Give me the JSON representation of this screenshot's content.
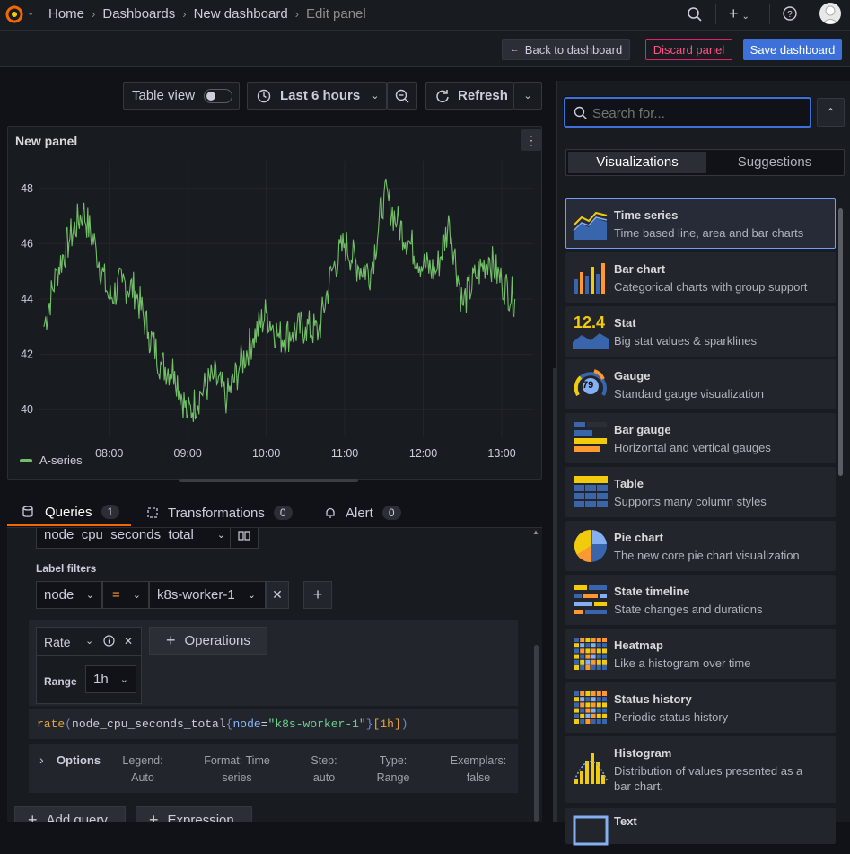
{
  "header": {
    "breadcrumb": [
      "Home",
      "Dashboards",
      "New dashboard",
      "Edit panel"
    ]
  },
  "toolbar": {
    "back_label": "Back to dashboard",
    "discard_label": "Discard panel",
    "save_label": "Save dashboard",
    "table_view_label": "Table view",
    "time_range_label": "Last 6 hours",
    "refresh_label": "Refresh"
  },
  "panel": {
    "title": "New panel",
    "legend": "A-series"
  },
  "chart_data": {
    "type": "line",
    "title": "New panel",
    "x": [
      "07:10",
      "07:20",
      "07:30",
      "07:40",
      "07:50",
      "08:00",
      "08:10",
      "08:20",
      "08:30",
      "08:40",
      "08:50",
      "09:00",
      "09:10",
      "09:20",
      "09:30",
      "09:40",
      "09:50",
      "10:00",
      "10:10",
      "10:20",
      "10:30",
      "10:40",
      "10:50",
      "11:00",
      "11:10",
      "11:20",
      "11:30",
      "11:40",
      "11:50",
      "12:00",
      "12:10",
      "12:20",
      "12:30",
      "12:40",
      "12:50",
      "13:00",
      "13:10"
    ],
    "series": [
      {
        "name": "A-series",
        "values": [
          43.0,
          45.0,
          46.2,
          47.2,
          45.8,
          44.0,
          44.6,
          44.3,
          42.8,
          41.6,
          41.4,
          39.8,
          40.6,
          41.2,
          40.4,
          41.6,
          42.6,
          43.5,
          42.6,
          42.8,
          43.0,
          42.8,
          45.0,
          46.0,
          45.2,
          45.0,
          47.8,
          46.8,
          46.0,
          45.2,
          45.0,
          46.8,
          43.8,
          44.8,
          45.5,
          44.6,
          44.0
        ]
      }
    ],
    "xticks": [
      "08:00",
      "09:00",
      "10:00",
      "11:00",
      "12:00",
      "13:00"
    ],
    "yticks": [
      40,
      42,
      44,
      46,
      48
    ],
    "ylim": [
      39,
      49
    ],
    "grid": true,
    "legend": "bottom-left",
    "colors": {
      "line": "#73bf69"
    }
  },
  "query_tabs": [
    {
      "label": "Queries",
      "count": "1"
    },
    {
      "label": "Transformations",
      "count": "0"
    },
    {
      "label": "Alert",
      "count": "0"
    }
  ],
  "query": {
    "metric": "node_cpu_seconds_total",
    "label_filters_title": "Label filters",
    "label": "node",
    "operator": "=",
    "value": "k8s-worker-1",
    "op_name": "Rate",
    "op_param_label": "Range",
    "op_param_value": "1h",
    "operations_label": "Operations",
    "promql_fn": "rate",
    "promql_metric": "node_cpu_seconds_total",
    "promql_label": "node",
    "promql_value": "\"k8s-worker-1\"",
    "promql_range": "[1h]",
    "options_label": "Options",
    "options": [
      {
        "k": "Legend:",
        "v": "Auto"
      },
      {
        "k": "Format: Time",
        "v": "series"
      },
      {
        "k": "Step:",
        "v": "auto"
      },
      {
        "k": "Type:",
        "v": "Range"
      },
      {
        "k": "Exemplars:",
        "v": "false"
      }
    ],
    "add_query_label": "Add query",
    "expression_label": "Expression"
  },
  "viz_picker": {
    "search_placeholder": "Search for...",
    "tabs": [
      "Visualizations",
      "Suggestions"
    ],
    "items": [
      {
        "title": "Time series",
        "desc": "Time based line, area and bar charts"
      },
      {
        "title": "Bar chart",
        "desc": "Categorical charts with group support"
      },
      {
        "title": "Stat",
        "desc": "Big stat values & sparklines",
        "icon_text": "12.4"
      },
      {
        "title": "Gauge",
        "desc": "Standard gauge visualization",
        "icon_text": "79"
      },
      {
        "title": "Bar gauge",
        "desc": "Horizontal and vertical gauges"
      },
      {
        "title": "Table",
        "desc": "Supports many column styles"
      },
      {
        "title": "Pie chart",
        "desc": "The new core pie chart visualization"
      },
      {
        "title": "State timeline",
        "desc": "State changes and durations"
      },
      {
        "title": "Heatmap",
        "desc": "Like a histogram over time"
      },
      {
        "title": "Status history",
        "desc": "Periodic status history"
      },
      {
        "title": "Histogram",
        "desc": "Distribution of values presented as a",
        "desc2": "bar chart."
      },
      {
        "title": "Text",
        "desc": ""
      }
    ]
  }
}
